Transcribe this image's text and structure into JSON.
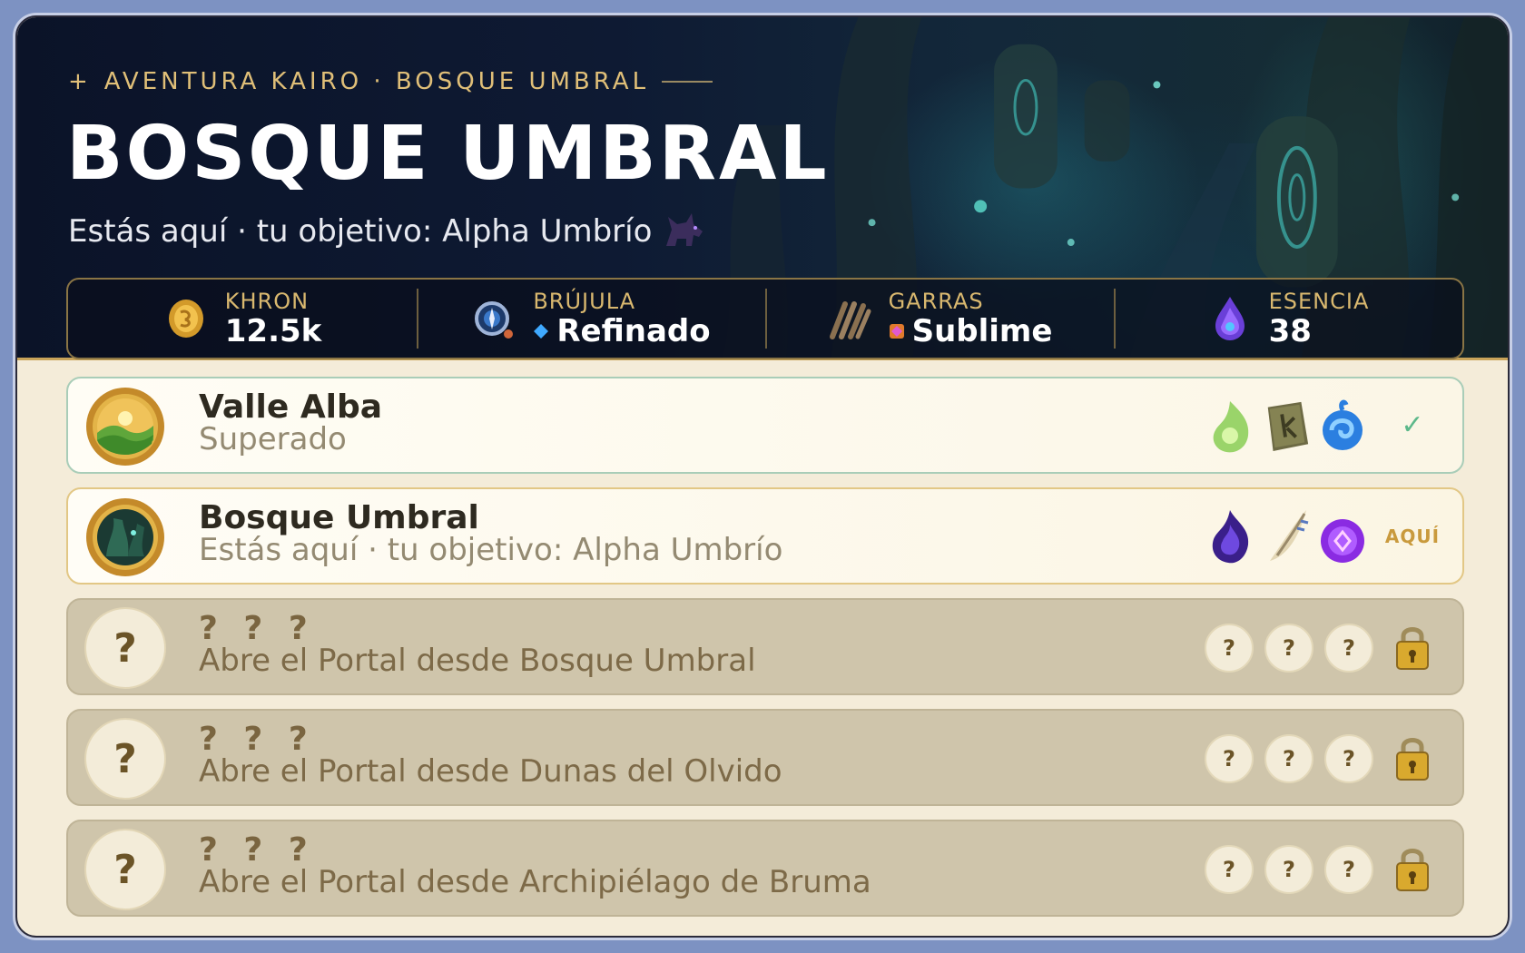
{
  "header": {
    "eyebrow": "AVENTURA KAIRO · BOSQUE UMBRAL",
    "eyebrow_icon": "sparkle-icon",
    "title": "BOSQUE UMBRAL",
    "subtitle": "Estás aquí · tu objetivo: Alpha Umbrío",
    "subtitle_icon": "shadow-wolf-icon"
  },
  "stats": [
    {
      "label": "KHRON",
      "value": "12.5k",
      "icon": "gold-coin-icon"
    },
    {
      "label": "BRÚJULA",
      "value": "Refinado",
      "icon": "compass-icon",
      "gem": "blue-diamond-icon"
    },
    {
      "label": "GARRAS",
      "value": "Sublime",
      "icon": "claws-icon",
      "gem": "pink-gem-icon"
    },
    {
      "label": "ESENCIA",
      "value": "38",
      "icon": "essence-drop-icon"
    }
  ],
  "zones": [
    {
      "name": "Valle Alba",
      "desc": "Superado",
      "state": "done",
      "status": "✓",
      "badge": "valley-emblem-icon",
      "rewards": [
        "green-spirit-icon",
        "rune-stone-icon",
        "blue-swirl-orb-icon"
      ]
    },
    {
      "name": "Bosque Umbral",
      "desc": "Estás aquí · tu objetivo: Alpha Umbrío",
      "state": "current",
      "status": "AQUÍ",
      "badge": "forest-emblem-icon",
      "rewards": [
        "purple-flame-icon",
        "bone-horn-icon",
        "violet-orb-icon"
      ]
    },
    {
      "name": "? ? ?",
      "desc": "Abre el Portal desde Bosque Umbral",
      "state": "locked",
      "badge_text": "?",
      "reward_text": "?",
      "status": "lock-icon"
    },
    {
      "name": "? ? ?",
      "desc": "Abre el Portal desde Dunas del Olvido",
      "state": "locked",
      "badge_text": "?",
      "reward_text": "?",
      "status": "lock-icon"
    },
    {
      "name": "? ? ?",
      "desc": "Abre el Portal desde Archipiélago de Bruma",
      "state": "locked",
      "badge_text": "?",
      "reward_text": "?",
      "status": "lock-icon"
    }
  ],
  "colors": {
    "accent_gold": "#d9b86f",
    "done_green": "#5cb88a",
    "here_gold": "#c99a3d",
    "header_dark": "#0e1a33",
    "panel_cream": "#f4ecd9",
    "locked_tan": "#cfc5ab"
  }
}
